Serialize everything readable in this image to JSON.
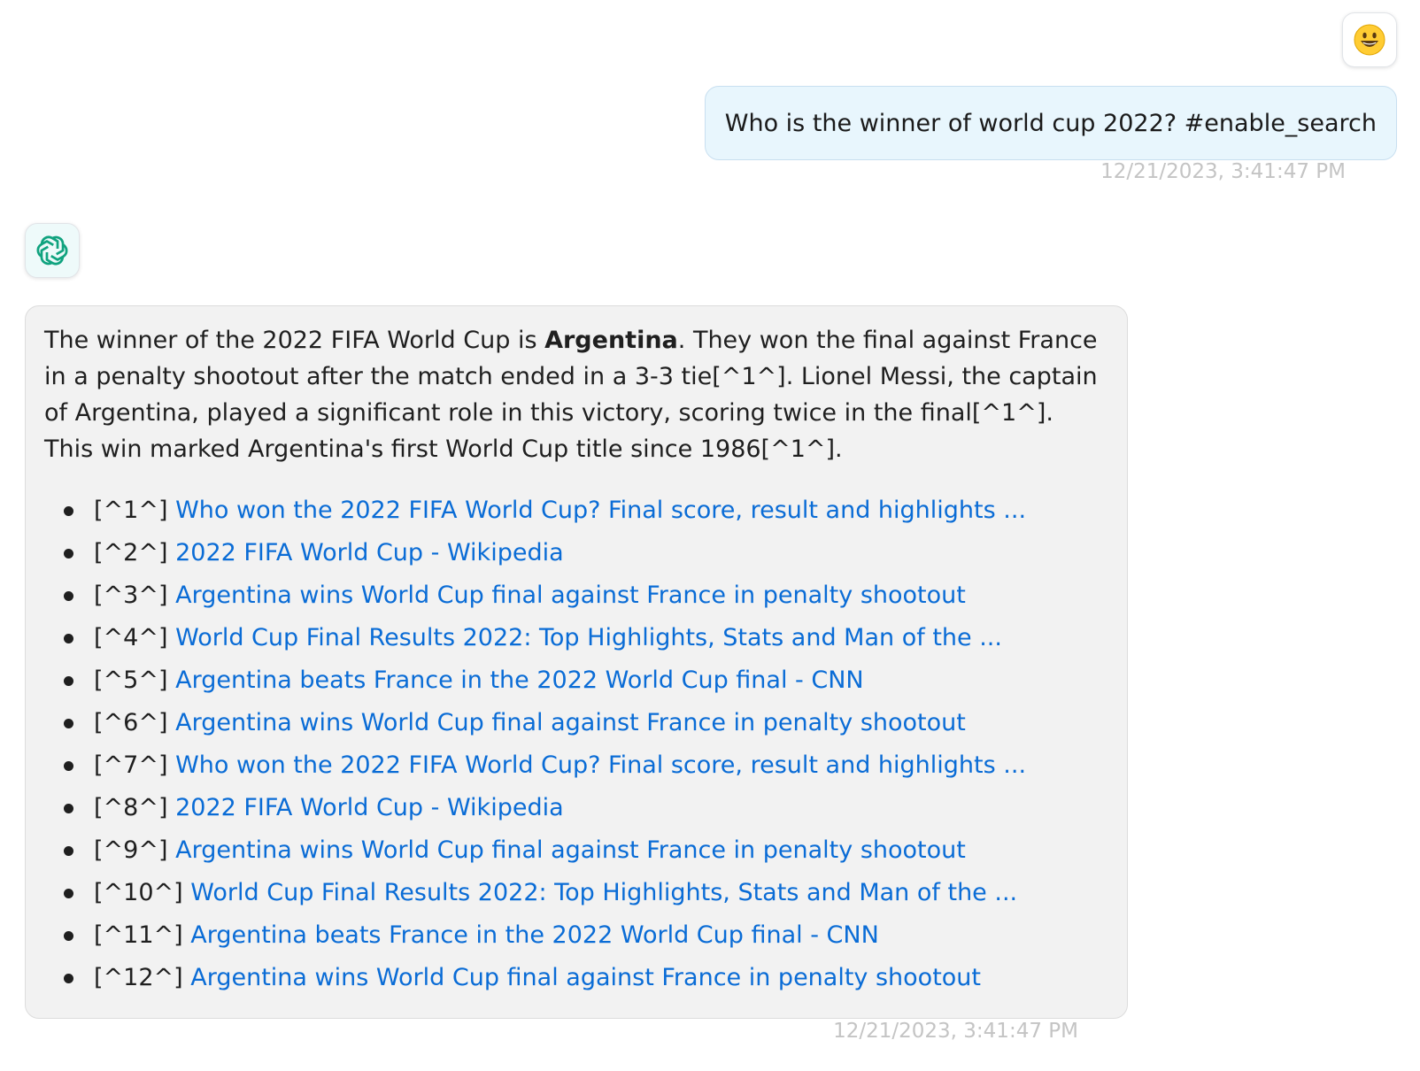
{
  "user": {
    "avatar_icon": "smiley-emoji-icon",
    "avatar_glyph": "😃",
    "message": "Who is the winner of world cup 2022? #enable_search",
    "timestamp": "12/21/2023, 3:41:47 PM"
  },
  "bot": {
    "avatar_icon": "openai-logo-icon",
    "answer": {
      "p1": "The winner of the 2022 FIFA World Cup is ",
      "bold": "Argentina",
      "p2": ". They won the final against France in a penalty shootout after the match ended in a 3-3 tie[^1^]. Lionel Messi, the captain of Argentina, played a significant role in this victory, scoring twice in the final[^1^]. This win marked Argentina's first World Cup title since 1986[^1^]."
    },
    "references": [
      {
        "tag": "[^1^]",
        "title": "Who won the 2022 FIFA World Cup? Final score, result and highlights ..."
      },
      {
        "tag": "[^2^]",
        "title": "2022 FIFA World Cup - Wikipedia"
      },
      {
        "tag": "[^3^]",
        "title": "Argentina wins World Cup final against France in penalty shootout"
      },
      {
        "tag": "[^4^]",
        "title": "World Cup Final Results 2022: Top Highlights, Stats and Man of the ..."
      },
      {
        "tag": "[^5^]",
        "title": "Argentina beats France in the 2022 World Cup final - CNN"
      },
      {
        "tag": "[^6^]",
        "title": "Argentina wins World Cup final against France in penalty shootout"
      },
      {
        "tag": "[^7^]",
        "title": "Who won the 2022 FIFA World Cup? Final score, result and highlights ..."
      },
      {
        "tag": "[^8^]",
        "title": "2022 FIFA World Cup - Wikipedia"
      },
      {
        "tag": "[^9^]",
        "title": "Argentina wins World Cup final against France in penalty shootout"
      },
      {
        "tag": "[^10^]",
        "title": "World Cup Final Results 2022: Top Highlights, Stats and Man of the ..."
      },
      {
        "tag": "[^11^]",
        "title": "Argentina beats France in the 2022 World Cup final - CNN"
      },
      {
        "tag": "[^12^]",
        "title": "Argentina wins World Cup final against France in penalty shootout"
      }
    ],
    "timestamp": "12/21/2023, 3:41:47 PM"
  },
  "colors": {
    "link": "#0a6cd6",
    "user_bubble": "#e8f6fd",
    "bot_bubble": "#f2f2f2",
    "timestamp": "#c4c4c4",
    "logo": "#10a37f"
  }
}
